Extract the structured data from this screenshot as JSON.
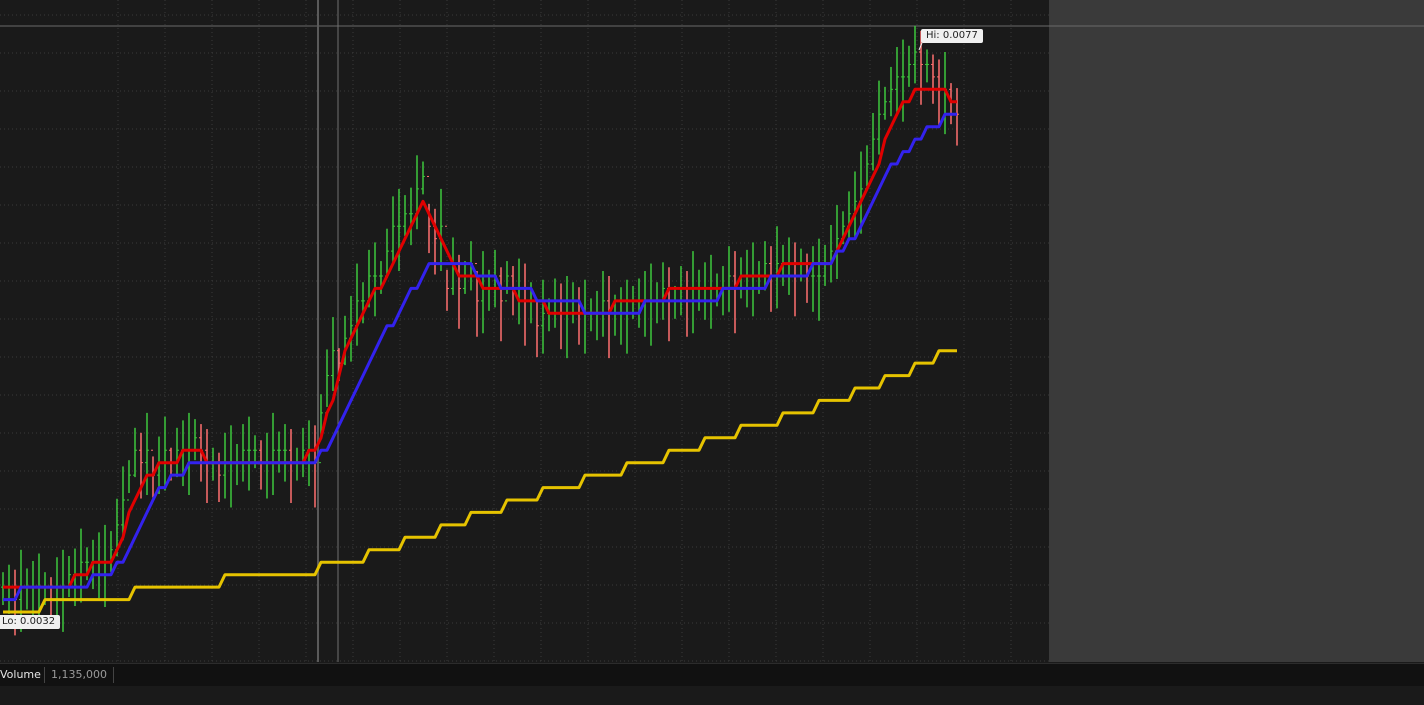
{
  "chart_data": {
    "type": "line",
    "title": "",
    "xlabel": "",
    "ylabel": "",
    "ylim": [
      0.0029,
      0.0082
    ],
    "x": [
      0,
      1,
      2,
      3,
      4,
      5,
      6,
      7,
      8,
      9,
      10,
      11,
      12,
      13,
      14,
      15,
      16,
      17,
      18,
      19,
      20,
      21,
      22,
      23,
      24,
      25,
      26,
      27,
      28,
      29,
      30,
      31,
      32,
      33,
      34,
      35,
      36,
      37,
      38,
      39,
      40,
      41,
      42,
      43,
      44,
      45,
      46,
      47,
      48,
      49,
      50,
      51,
      52,
      53,
      54,
      55,
      56,
      57,
      58,
      59,
      60,
      61,
      62,
      63,
      64,
      65,
      66,
      67,
      68,
      69,
      70,
      71,
      72,
      73,
      74,
      75,
      76,
      77,
      78,
      79,
      80,
      81,
      82,
      83,
      84,
      85,
      86,
      87,
      88,
      89,
      90,
      91,
      92,
      93,
      94,
      95,
      96,
      97,
      98,
      99,
      100,
      101,
      102,
      103,
      104,
      105,
      106,
      107,
      108,
      109,
      110,
      111,
      112,
      113,
      114,
      115,
      116,
      117,
      118,
      119,
      120,
      121,
      122,
      123,
      124,
      125,
      126,
      127,
      128,
      129,
      130,
      131,
      132,
      133,
      134,
      135,
      136,
      137,
      138,
      139,
      140,
      141,
      142,
      143,
      144,
      145,
      146,
      147,
      148,
      149,
      150,
      151,
      152,
      153,
      154,
      155,
      156,
      157,
      158,
      159
    ],
    "series": [
      {
        "name": "",
        "color": "#ff7070",
        "style": "price-bars",
        "values": [
          0.0034,
          0.0034,
          0.0033,
          0.0034,
          0.0034,
          0.0034,
          0.0034,
          0.0034,
          0.0033,
          0.0034,
          0.0034,
          0.0035,
          0.0035,
          0.0036,
          0.0036,
          0.0036,
          0.0036,
          0.0036,
          0.0037,
          0.0039,
          0.0041,
          0.0043,
          0.0045,
          0.0044,
          0.0045,
          0.0043,
          0.0044,
          0.0045,
          0.0044,
          0.0045,
          0.0045,
          0.0045,
          0.0046,
          0.0045,
          0.0044,
          0.0044,
          0.0043,
          0.0044,
          0.0044,
          0.0044,
          0.0045,
          0.0045,
          0.0045,
          0.0044,
          0.0044,
          0.0045,
          0.0045,
          0.0045,
          0.0044,
          0.0044,
          0.0045,
          0.0045,
          0.0044,
          0.0048,
          0.0051,
          0.0053,
          0.0052,
          0.0054,
          0.0055,
          0.0057,
          0.0057,
          0.0059,
          0.0059,
          0.0059,
          0.0061,
          0.0063,
          0.0063,
          0.0064,
          0.0064,
          0.0066,
          0.0067,
          0.0063,
          0.0062,
          0.0063,
          0.0058,
          0.006,
          0.0058,
          0.0059,
          0.006,
          0.0057,
          0.0058,
          0.0058,
          0.0059,
          0.0057,
          0.0059,
          0.0058,
          0.0058,
          0.0057,
          0.0057,
          0.0055,
          0.0056,
          0.0056,
          0.0057,
          0.0056,
          0.0056,
          0.0057,
          0.0056,
          0.0056,
          0.0056,
          0.0056,
          0.0057,
          0.0056,
          0.0056,
          0.0056,
          0.0056,
          0.0057,
          0.0057,
          0.0057,
          0.0057,
          0.0057,
          0.0058,
          0.0057,
          0.0057,
          0.0058,
          0.0057,
          0.0058,
          0.0058,
          0.0058,
          0.0058,
          0.0058,
          0.0058,
          0.0059,
          0.0058,
          0.0059,
          0.0059,
          0.0059,
          0.0059,
          0.006,
          0.0059,
          0.006,
          0.006,
          0.006,
          0.0059,
          0.006,
          0.0059,
          0.0059,
          0.0059,
          0.006,
          0.0061,
          0.0062,
          0.0063,
          0.0064,
          0.0065,
          0.0066,
          0.0068,
          0.007,
          0.0072,
          0.0073,
          0.0074,
          0.0075,
          0.0075,
          0.0076,
          0.0077,
          0.0076,
          0.0076,
          0.0075,
          0.0074,
          0.0074,
          0.0073,
          0.0072
        ]
      },
      {
        "name": "",
        "color": "#e00000",
        "style": "line",
        "values": [
          0.0034,
          0.0034,
          0.0034,
          0.0034,
          0.0034,
          0.0034,
          0.0034,
          0.0034,
          0.0034,
          0.0034,
          0.0034,
          0.0034,
          0.0035,
          0.0035,
          0.0035,
          0.0036,
          0.0036,
          0.0036,
          0.0036,
          0.0037,
          0.0038,
          0.004,
          0.0041,
          0.0042,
          0.0043,
          0.0043,
          0.0044,
          0.0044,
          0.0044,
          0.0044,
          0.0045,
          0.0045,
          0.0045,
          0.0045,
          0.0044,
          0.0044,
          0.0044,
          0.0044,
          0.0044,
          0.0044,
          0.0044,
          0.0044,
          0.0044,
          0.0044,
          0.0044,
          0.0044,
          0.0044,
          0.0044,
          0.0044,
          0.0044,
          0.0044,
          0.0045,
          0.0045,
          0.0046,
          0.0048,
          0.0049,
          0.0051,
          0.0053,
          0.0054,
          0.0055,
          0.0056,
          0.0057,
          0.0058,
          0.0058,
          0.0059,
          0.006,
          0.0061,
          0.0062,
          0.0063,
          0.0064,
          0.0065,
          0.0064,
          0.0063,
          0.0062,
          0.0061,
          0.006,
          0.0059,
          0.0059,
          0.0059,
          0.0059,
          0.0058,
          0.0058,
          0.0058,
          0.0058,
          0.0058,
          0.0058,
          0.0057,
          0.0057,
          0.0057,
          0.0057,
          0.0057,
          0.0056,
          0.0056,
          0.0056,
          0.0056,
          0.0056,
          0.0056,
          0.0056,
          0.0056,
          0.0056,
          0.0056,
          0.0056,
          0.0057,
          0.0057,
          0.0057,
          0.0057,
          0.0057,
          0.0057,
          0.0057,
          0.0057,
          0.0057,
          0.0058,
          0.0058,
          0.0058,
          0.0058,
          0.0058,
          0.0058,
          0.0058,
          0.0058,
          0.0058,
          0.0058,
          0.0058,
          0.0058,
          0.0059,
          0.0059,
          0.0059,
          0.0059,
          0.0059,
          0.0059,
          0.0059,
          0.006,
          0.006,
          0.006,
          0.006,
          0.006,
          0.006,
          0.006,
          0.006,
          0.006,
          0.0061,
          0.0062,
          0.0063,
          0.0064,
          0.0065,
          0.0066,
          0.0067,
          0.0068,
          0.007,
          0.0071,
          0.0072,
          0.0073,
          0.0073,
          0.0074,
          0.0074,
          0.0074,
          0.0074,
          0.0074,
          0.0074,
          0.0073,
          0.0073
        ]
      },
      {
        "name": "",
        "color": "#3322ee",
        "style": "line",
        "values": [
          0.0033,
          0.0033,
          0.0033,
          0.0034,
          0.0034,
          0.0034,
          0.0034,
          0.0034,
          0.0034,
          0.0034,
          0.0034,
          0.0034,
          0.0034,
          0.0034,
          0.0034,
          0.0035,
          0.0035,
          0.0035,
          0.0035,
          0.0036,
          0.0036,
          0.0037,
          0.0038,
          0.0039,
          0.004,
          0.0041,
          0.0042,
          0.0042,
          0.0043,
          0.0043,
          0.0043,
          0.0044,
          0.0044,
          0.0044,
          0.0044,
          0.0044,
          0.0044,
          0.0044,
          0.0044,
          0.0044,
          0.0044,
          0.0044,
          0.0044,
          0.0044,
          0.0044,
          0.0044,
          0.0044,
          0.0044,
          0.0044,
          0.0044,
          0.0044,
          0.0044,
          0.0044,
          0.0045,
          0.0045,
          0.0046,
          0.0047,
          0.0048,
          0.0049,
          0.005,
          0.0051,
          0.0052,
          0.0053,
          0.0054,
          0.0055,
          0.0055,
          0.0056,
          0.0057,
          0.0058,
          0.0058,
          0.0059,
          0.006,
          0.006,
          0.006,
          0.006,
          0.006,
          0.006,
          0.006,
          0.006,
          0.0059,
          0.0059,
          0.0059,
          0.0059,
          0.0058,
          0.0058,
          0.0058,
          0.0058,
          0.0058,
          0.0058,
          0.0057,
          0.0057,
          0.0057,
          0.0057,
          0.0057,
          0.0057,
          0.0057,
          0.0057,
          0.0056,
          0.0056,
          0.0056,
          0.0056,
          0.0056,
          0.0056,
          0.0056,
          0.0056,
          0.0056,
          0.0056,
          0.0057,
          0.0057,
          0.0057,
          0.0057,
          0.0057,
          0.0057,
          0.0057,
          0.0057,
          0.0057,
          0.0057,
          0.0057,
          0.0057,
          0.0057,
          0.0058,
          0.0058,
          0.0058,
          0.0058,
          0.0058,
          0.0058,
          0.0058,
          0.0058,
          0.0059,
          0.0059,
          0.0059,
          0.0059,
          0.0059,
          0.0059,
          0.0059,
          0.006,
          0.006,
          0.006,
          0.006,
          0.0061,
          0.0061,
          0.0062,
          0.0062,
          0.0063,
          0.0064,
          0.0065,
          0.0066,
          0.0067,
          0.0068,
          0.0068,
          0.0069,
          0.0069,
          0.007,
          0.007,
          0.0071,
          0.0071,
          0.0071,
          0.0072,
          0.0072,
          0.0072
        ]
      },
      {
        "name": "",
        "color": "#e6c300",
        "style": "line",
        "values": [
          0.0032,
          0.0032,
          0.0032,
          0.0032,
          0.0032,
          0.0032,
          0.0032,
          0.0033,
          0.0033,
          0.0033,
          0.0033,
          0.0033,
          0.0033,
          0.0033,
          0.0033,
          0.0033,
          0.0033,
          0.0033,
          0.0033,
          0.0033,
          0.0033,
          0.0033,
          0.0034,
          0.0034,
          0.0034,
          0.0034,
          0.0034,
          0.0034,
          0.0034,
          0.0034,
          0.0034,
          0.0034,
          0.0034,
          0.0034,
          0.0034,
          0.0034,
          0.0034,
          0.0035,
          0.0035,
          0.0035,
          0.0035,
          0.0035,
          0.0035,
          0.0035,
          0.0035,
          0.0035,
          0.0035,
          0.0035,
          0.0035,
          0.0035,
          0.0035,
          0.0035,
          0.0035,
          0.0036,
          0.0036,
          0.0036,
          0.0036,
          0.0036,
          0.0036,
          0.0036,
          0.0036,
          0.0037,
          0.0037,
          0.0037,
          0.0037,
          0.0037,
          0.0037,
          0.0038,
          0.0038,
          0.0038,
          0.0038,
          0.0038,
          0.0038,
          0.0039,
          0.0039,
          0.0039,
          0.0039,
          0.0039,
          0.004,
          0.004,
          0.004,
          0.004,
          0.004,
          0.004,
          0.0041,
          0.0041,
          0.0041,
          0.0041,
          0.0041,
          0.0041,
          0.0042,
          0.0042,
          0.0042,
          0.0042,
          0.0042,
          0.0042,
          0.0042,
          0.0043,
          0.0043,
          0.0043,
          0.0043,
          0.0043,
          0.0043,
          0.0043,
          0.0044,
          0.0044,
          0.0044,
          0.0044,
          0.0044,
          0.0044,
          0.0044,
          0.0045,
          0.0045,
          0.0045,
          0.0045,
          0.0045,
          0.0045,
          0.0046,
          0.0046,
          0.0046,
          0.0046,
          0.0046,
          0.0046,
          0.0047,
          0.0047,
          0.0047,
          0.0047,
          0.0047,
          0.0047,
          0.0047,
          0.0048,
          0.0048,
          0.0048,
          0.0048,
          0.0048,
          0.0048,
          0.0049,
          0.0049,
          0.0049,
          0.0049,
          0.0049,
          0.0049,
          0.005,
          0.005,
          0.005,
          0.005,
          0.005,
          0.0051,
          0.0051,
          0.0051,
          0.0051,
          0.0051,
          0.0052,
          0.0052,
          0.0052,
          0.0052,
          0.0053,
          0.0053,
          0.0053,
          0.0053
        ]
      }
    ],
    "annotations": [
      {
        "label": "Hi: 0.0077",
        "value": 0.0077,
        "x": 154
      },
      {
        "label": "Lo: 0.0032",
        "value": 0.0032,
        "x": 0
      }
    ],
    "grid": true,
    "legend": "none"
  },
  "volume": {
    "label": "Volume",
    "value": "1,135,000"
  },
  "colors": {
    "background": "#1a1a1a",
    "future_area": "#3a3a3a",
    "up_bar": "#3cc83c",
    "down_bar": "#ff7070",
    "grid": "#3a3a3a"
  }
}
